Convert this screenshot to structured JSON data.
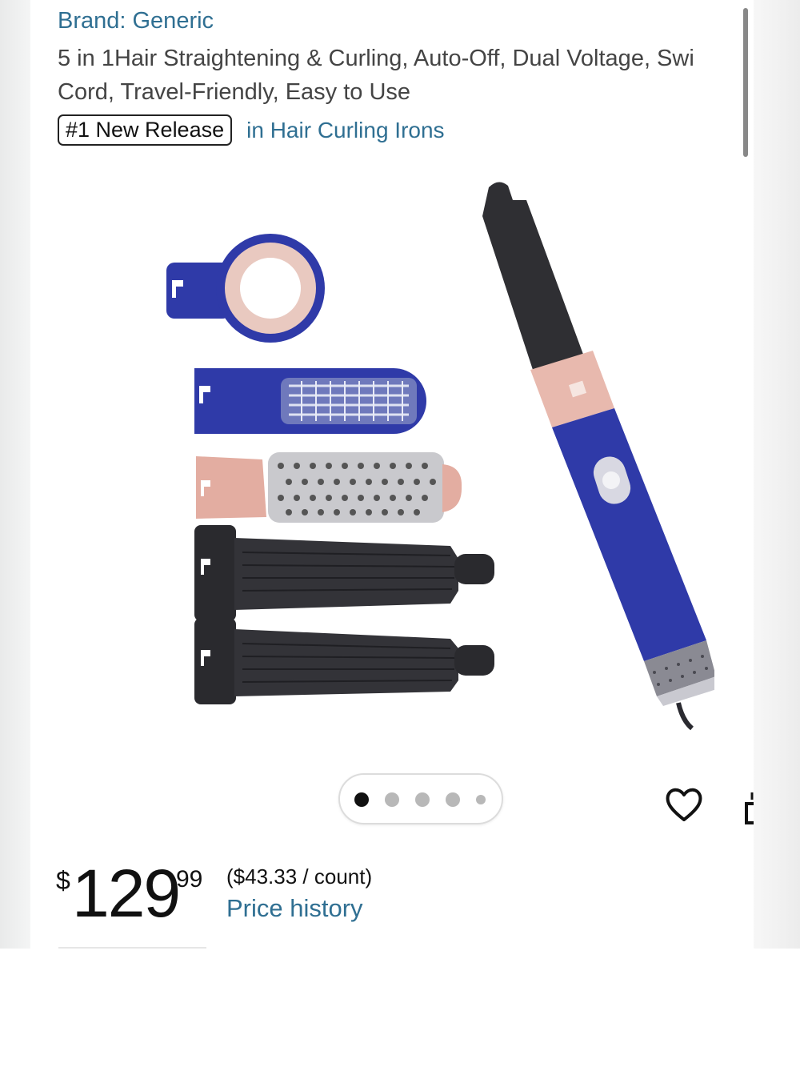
{
  "product": {
    "brand_line": "Brand: Generic",
    "title_line1": "5 in 1Hair Straightening & Curling, Auto-Off, Dual Voltage, Swi",
    "title_line2": "Cord, Travel-Friendly, Easy to Use",
    "badge": "#1 New Release",
    "badge_category": "in Hair Curling Irons",
    "image_name": "hair-styler-set"
  },
  "carousel": {
    "count": 5,
    "active_index": 0
  },
  "actions": {
    "favorite_icon": "heart-icon",
    "share_icon": "share-icon"
  },
  "price": {
    "currency": "$",
    "whole": "129",
    "fraction": "99",
    "per_unit": "($43.33 / count)",
    "history_link": "Price history"
  },
  "colors": {
    "link": "#2f6f92",
    "styler_blue": "#2f3aa8",
    "styler_pink": "#e8b9ae",
    "active_dot": "#111111",
    "inactive_dot": "#b8b8b8"
  }
}
